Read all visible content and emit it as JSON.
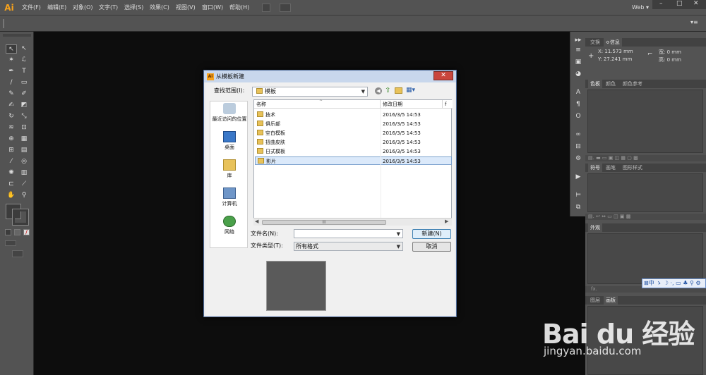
{
  "app": {
    "logo": "Ai",
    "workspace": "Web",
    "workspace_arrow": "▾"
  },
  "menu": [
    "文件(F)",
    "编辑(E)",
    "对象(O)",
    "文字(T)",
    "选择(S)",
    "效果(C)",
    "视图(V)",
    "窗口(W)",
    "帮助(H)"
  ],
  "window_controls": {
    "minimize": "–",
    "maximize": "□",
    "close": "✕"
  },
  "info_panel": {
    "tabs": [
      "交换",
      "≎信息"
    ],
    "x_label": "X: 11.573 mm",
    "y_label": "Y: 27.241 mm",
    "w_label": "宽: 0 mm",
    "h_label": "高: 0 mm"
  },
  "color_panel": {
    "tabs": [
      "色板",
      "颜色",
      "颜色参考"
    ]
  },
  "symbol_panel": {
    "tabs": [
      "符号",
      "画笔",
      "图形样式"
    ]
  },
  "appearance_panel": {
    "tabs": [
      "外观"
    ],
    "footer": "fx."
  },
  "layers_panel": {
    "tabs": [
      "图层",
      "画板"
    ]
  },
  "ime_bar": {
    "text": "⊠中 ゝ ☽ ·, ▭ ♣ ⚲ ⚙"
  },
  "dialog": {
    "title": "从模板新建",
    "close": "✕",
    "look_in_label": "查找范围(I):",
    "look_in_value": "模板",
    "places": [
      "最近访问的位置",
      "桌面",
      "库",
      "计算机",
      "网络"
    ],
    "columns": {
      "name": "名称",
      "date": "修改日期",
      "extra": "f"
    },
    "files": [
      {
        "name": "技术",
        "date": "2016/3/5 14:53"
      },
      {
        "name": "俱乐部",
        "date": "2016/3/5 14:53"
      },
      {
        "name": "空白模板",
        "date": "2016/3/5 14:53"
      },
      {
        "name": "扭曲皮肤",
        "date": "2016/3/5 14:53"
      },
      {
        "name": "日式模板",
        "date": "2016/3/5 14:53"
      },
      {
        "name": "影片",
        "date": "2016/3/5 14:53"
      }
    ],
    "scroll_marker": "III",
    "filename_label": "文件名(N):",
    "filename_value": "",
    "filetype_label": "文件类型(T):",
    "filetype_value": "所有格式",
    "new_button": "新建(N)",
    "cancel_button": "取消"
  },
  "watermark": {
    "brand": "Bai du 经验",
    "url": "jingyan.baidu.com"
  },
  "colors": {
    "ui": "#535353",
    "accent": "#f7a21b",
    "canvas": "#0d0d0d"
  }
}
